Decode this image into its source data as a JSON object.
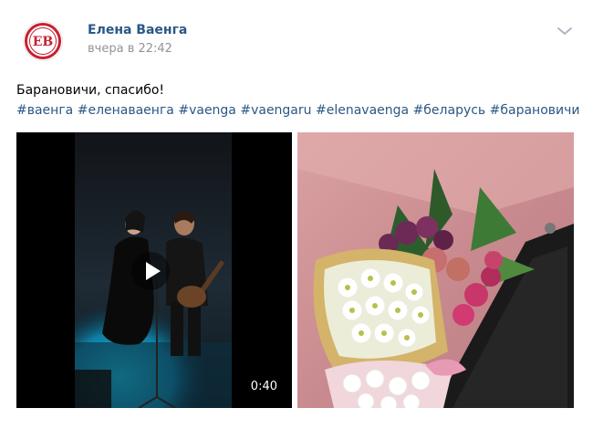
{
  "post": {
    "author": "Елена Ваенга",
    "timestamp": "вчера в 22:42",
    "text": "Барановичи, спасибо!",
    "hashtags": [
      "#ваенга",
      "#еленаваенга",
      "#vaenga",
      "#vaengaru",
      "#elenavaenga",
      "#беларусь",
      "#барановичи"
    ],
    "avatar_letters": "ЕВ",
    "video": {
      "duration": "0:40"
    }
  },
  "colors": {
    "link": "#2a5885",
    "meta": "#939393",
    "avatar_red": "#c8202f",
    "stage_blue": "#17a6c8"
  },
  "icons": {
    "menu": "chevron-down-icon",
    "video": "play-icon"
  }
}
